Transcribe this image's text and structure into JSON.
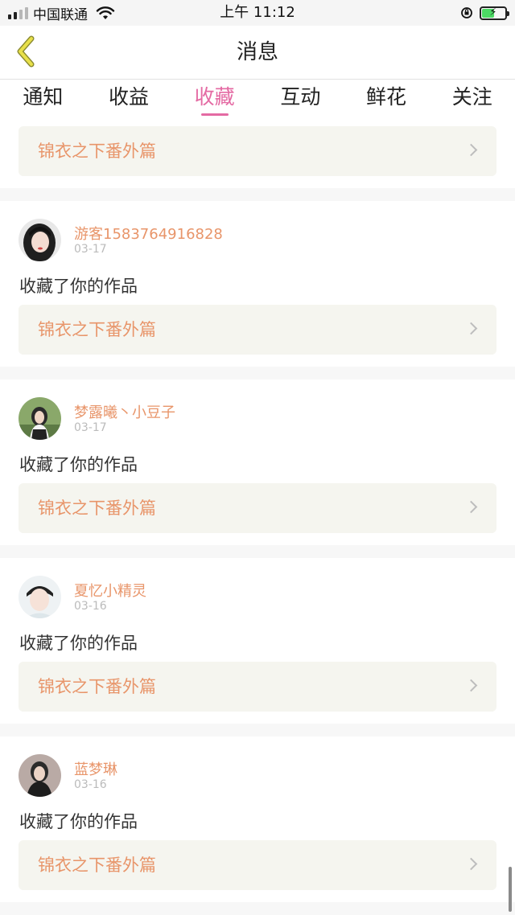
{
  "status_bar": {
    "carrier": "中国联通",
    "time": "上午 11:12",
    "battery_level": 0.55,
    "icons": [
      "signal-icon",
      "wifi-icon",
      "orientation-lock-icon",
      "battery-icon"
    ]
  },
  "nav": {
    "title": "消息",
    "back_icon": "chevron-left-icon",
    "accent_color": "#e8e04a"
  },
  "tabs": [
    {
      "label": "通知",
      "active": false
    },
    {
      "label": "收益",
      "active": false
    },
    {
      "label": "收藏",
      "active": true
    },
    {
      "label": "互动",
      "active": false
    },
    {
      "label": "鲜花",
      "active": false
    },
    {
      "label": "关注",
      "active": false
    }
  ],
  "colors": {
    "active_tab": "#e46aa3",
    "link_orange": "#e8956a",
    "work_box_bg": "#f5f5ef"
  },
  "top_card": {
    "work_title": "锦衣之下番外篇"
  },
  "cards": [
    {
      "username": "游客1583764916828",
      "date": "03-17",
      "action": "收藏了你的作品",
      "work_title": "锦衣之下番外篇"
    },
    {
      "username": "梦露曦丶小豆子",
      "date": "03-17",
      "action": "收藏了你的作品",
      "work_title": "锦衣之下番外篇"
    },
    {
      "username": "夏忆小精灵",
      "date": "03-16",
      "action": "收藏了你的作品",
      "work_title": "锦衣之下番外篇"
    },
    {
      "username": "蓝梦琳",
      "date": "03-16",
      "action": "收藏了你的作品",
      "work_title": "锦衣之下番外篇"
    }
  ]
}
